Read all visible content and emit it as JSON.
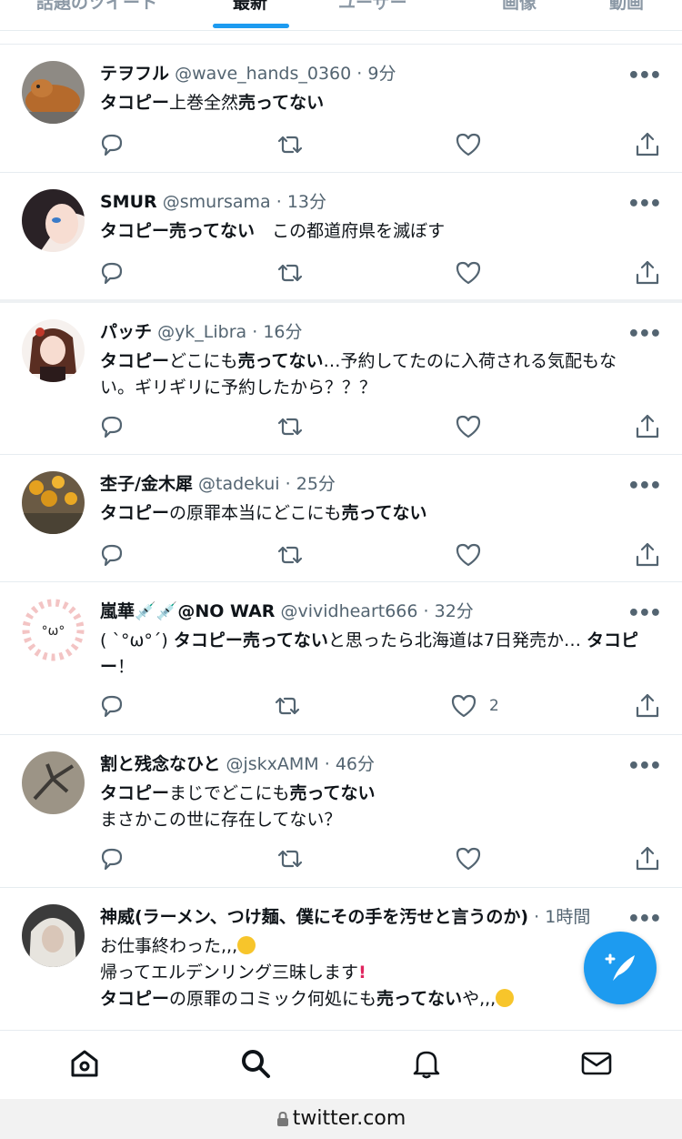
{
  "tabs": [
    {
      "label": "話題のツイート",
      "active": false
    },
    {
      "label": "最新",
      "active": true
    },
    {
      "label": "ユーザー",
      "active": false
    },
    {
      "label": "画像",
      "active": false
    },
    {
      "label": "動画",
      "active": false
    }
  ],
  "tweets": [
    {
      "name": "テヲフル",
      "handle": "@wave_hands_0360",
      "time": "9分",
      "lines": [
        [
          [
            "タコピー",
            true
          ],
          [
            "上巻全然",
            false
          ],
          [
            "売ってない",
            true
          ]
        ]
      ],
      "likes": ""
    },
    {
      "name": "SMUR",
      "handle": "@smursama",
      "time": "13分",
      "lines": [
        [
          [
            "タコピー売ってない",
            true
          ],
          [
            "　この都道府県を滅ぼす",
            false
          ]
        ]
      ],
      "likes": ""
    },
    {
      "name": "パッチ",
      "handle": "@yk_Libra",
      "time": "16分",
      "lines": [
        [
          [
            "タコピー",
            true
          ],
          [
            "どこにも",
            false
          ],
          [
            "売ってない",
            true
          ],
          [
            "…予約してたのに入荷される気配もな",
            false
          ]
        ],
        [
          [
            "い。ギリギリに予約したから？？？",
            false
          ]
        ]
      ],
      "likes": ""
    },
    {
      "name": "杢子/金木犀",
      "handle": "@tadekui",
      "time": "25分",
      "lines": [
        [
          [
            "タコピー",
            true
          ],
          [
            "の原罪本当にどこにも",
            false
          ],
          [
            "売ってない",
            true
          ]
        ]
      ],
      "likes": ""
    },
    {
      "name": "嵐華💉💉@NO WAR",
      "handle": "@vividheart666",
      "time": "32分",
      "lines": [
        [
          [
            "( ˋ°ω°ˊ) ",
            false
          ],
          [
            "タコピー売ってない",
            true
          ],
          [
            "と思ったら北海道は7日発売か… ",
            false
          ],
          [
            "タコピ",
            true
          ]
        ],
        [
          [
            "ー",
            true
          ],
          [
            "！",
            false
          ]
        ]
      ],
      "likes": "2"
    },
    {
      "name": "割と残念なひと",
      "handle": "@jskxAMM",
      "time": "46分",
      "lines": [
        [
          [
            "タコピー",
            true
          ],
          [
            "まじでどこにも",
            false
          ],
          [
            "売ってない",
            true
          ]
        ],
        [
          [
            "まさかこの世に存在してない？",
            false
          ]
        ]
      ],
      "likes": ""
    },
    {
      "name": "神威(ラーメン、つけ麺、僕にその手を汚せと言うのか)",
      "handle": "",
      "time": "1時間",
      "lines": [
        [
          [
            "お仕事終わった,,,",
            false
          ]
        ],
        [
          [
            "帰ってエルデンリング三昧します",
            false
          ]
        ],
        [
          [
            "タコピー",
            true
          ],
          [
            "の原罪のコミック何処にも",
            false
          ],
          [
            "売ってない",
            true
          ],
          [
            "や,,,",
            false
          ]
        ]
      ],
      "likes": ""
    }
  ],
  "url": "twitter.com",
  "colors": {
    "accent": "#1d9bf0",
    "text": "#0f1419",
    "muted": "#536471"
  }
}
